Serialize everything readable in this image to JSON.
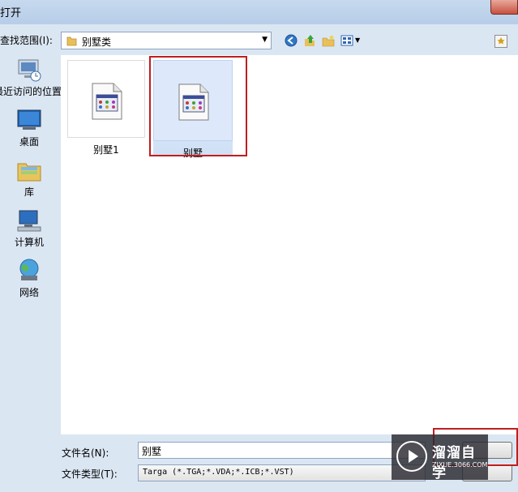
{
  "window": {
    "title": "打开"
  },
  "toolbar": {
    "look_in_label": "查找范围(I):",
    "look_in_value": "别墅类"
  },
  "places": [
    {
      "label": "最近访问的位置",
      "icon": "recent-places-icon"
    },
    {
      "label": "桌面",
      "icon": "desktop-icon"
    },
    {
      "label": "库",
      "icon": "libraries-icon"
    },
    {
      "label": "计算机",
      "icon": "computer-icon"
    },
    {
      "label": "网络",
      "icon": "network-icon"
    }
  ],
  "files": [
    {
      "name": "别墅1",
      "icon": "image-file-icon",
      "selected": false
    },
    {
      "name": "别墅",
      "icon": "image-file-icon",
      "selected": true
    }
  ],
  "bottom": {
    "file_name_label": "文件名(N):",
    "file_name_value": "别墅",
    "file_type_label": "文件类型(T):",
    "file_type_value": "Targa (*.TGA;*.VDA;*.ICB;*.VST)"
  },
  "watermark": {
    "title": "溜溜自学",
    "subtitle": "ZIXUE.3066.COM"
  },
  "colors": {
    "selection_highlight": "#c01e1e",
    "window_background": "#dbe6f3"
  }
}
